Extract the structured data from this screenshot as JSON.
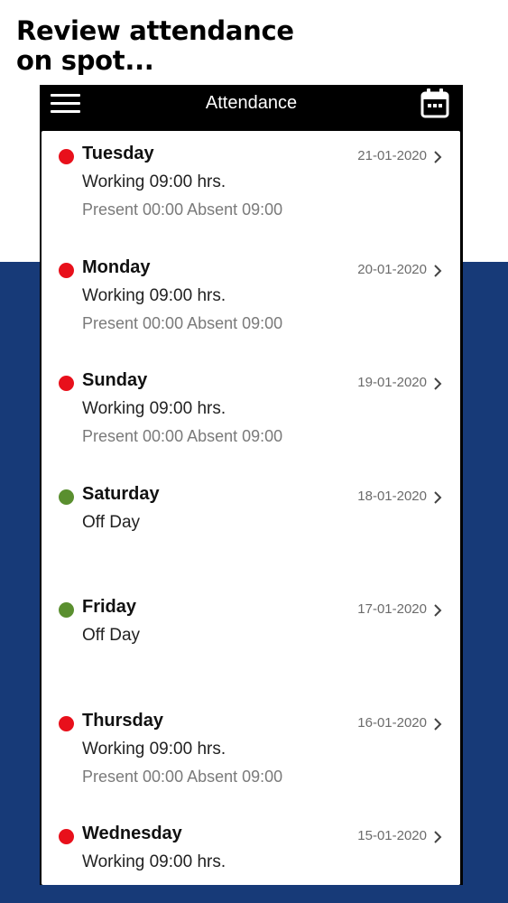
{
  "promo": {
    "headline_line1": "Review attendance",
    "headline_line2": "on spot..."
  },
  "appbar": {
    "title": "Attendance",
    "menu_icon": "hamburger-menu-icon",
    "calendar_icon": "calendar-icon"
  },
  "colors": {
    "absent_dot": "#e8101b",
    "off_day_dot": "#5a8f2f",
    "band": "#173a78"
  },
  "items": [
    {
      "day": "Tuesday",
      "date": "21-01-2020",
      "status": "absent",
      "line1": "Working 09:00 hrs.",
      "line2": "Present 00:00 Absent 09:00"
    },
    {
      "day": "Monday",
      "date": "20-01-2020",
      "status": "absent",
      "line1": "Working 09:00 hrs.",
      "line2": "Present 00:00 Absent 09:00"
    },
    {
      "day": "Sunday",
      "date": "19-01-2020",
      "status": "absent",
      "line1": "Working 09:00 hrs.",
      "line2": "Present 00:00 Absent 09:00"
    },
    {
      "day": "Saturday",
      "date": "18-01-2020",
      "status": "off",
      "line1": "Off Day",
      "line2": ""
    },
    {
      "day": "Friday",
      "date": "17-01-2020",
      "status": "off",
      "line1": "Off Day",
      "line2": ""
    },
    {
      "day": "Thursday",
      "date": "16-01-2020",
      "status": "absent",
      "line1": "Working 09:00 hrs.",
      "line2": "Present 00:00 Absent 09:00"
    },
    {
      "day": "Wednesday",
      "date": "15-01-2020",
      "status": "absent",
      "line1": "Working 09:00 hrs.",
      "line2": ""
    }
  ]
}
